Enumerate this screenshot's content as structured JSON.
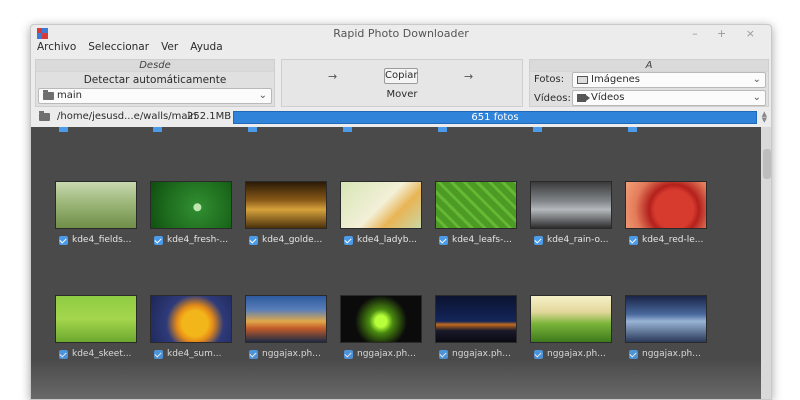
{
  "window": {
    "title": "Rapid Photo Downloader",
    "controls": "– + ×"
  },
  "menu": [
    "Archivo",
    "Seleccionar",
    "Ver",
    "Ayuda"
  ],
  "source": {
    "header": "Desde",
    "detect_label": "Detectar automáticamente",
    "device": "main"
  },
  "actions": {
    "copy": "Copiar",
    "move": "Mover",
    "arrow": "→"
  },
  "destination": {
    "header": "A",
    "photos_label": "Fotos:",
    "photos_value": "Imágenes",
    "videos_label": "Vídeos:",
    "videos_value": "Vídeos"
  },
  "path_bar": {
    "path": "/home/jesusd...e/walls/main",
    "size": "252.1MB",
    "progress_text": "651 fotos",
    "progress_fraction": 1.0
  },
  "thumbnails": [
    {
      "caption": "kde4_fields..."
    },
    {
      "caption": "kde4_fresh-..."
    },
    {
      "caption": "kde4_golde..."
    },
    {
      "caption": "kde4_ladyb..."
    },
    {
      "caption": "kde4_leafs-..."
    },
    {
      "caption": "kde4_rain-o..."
    },
    {
      "caption": "kde4_red-le..."
    },
    {
      "caption": "kde4_skeet..."
    },
    {
      "caption": "kde4_sum..."
    },
    {
      "caption": "nggajax.ph..."
    },
    {
      "caption": "nggajax.ph..."
    },
    {
      "caption": "nggajax.ph..."
    },
    {
      "caption": "nggajax.ph..."
    },
    {
      "caption": "nggajax.ph..."
    }
  ]
}
